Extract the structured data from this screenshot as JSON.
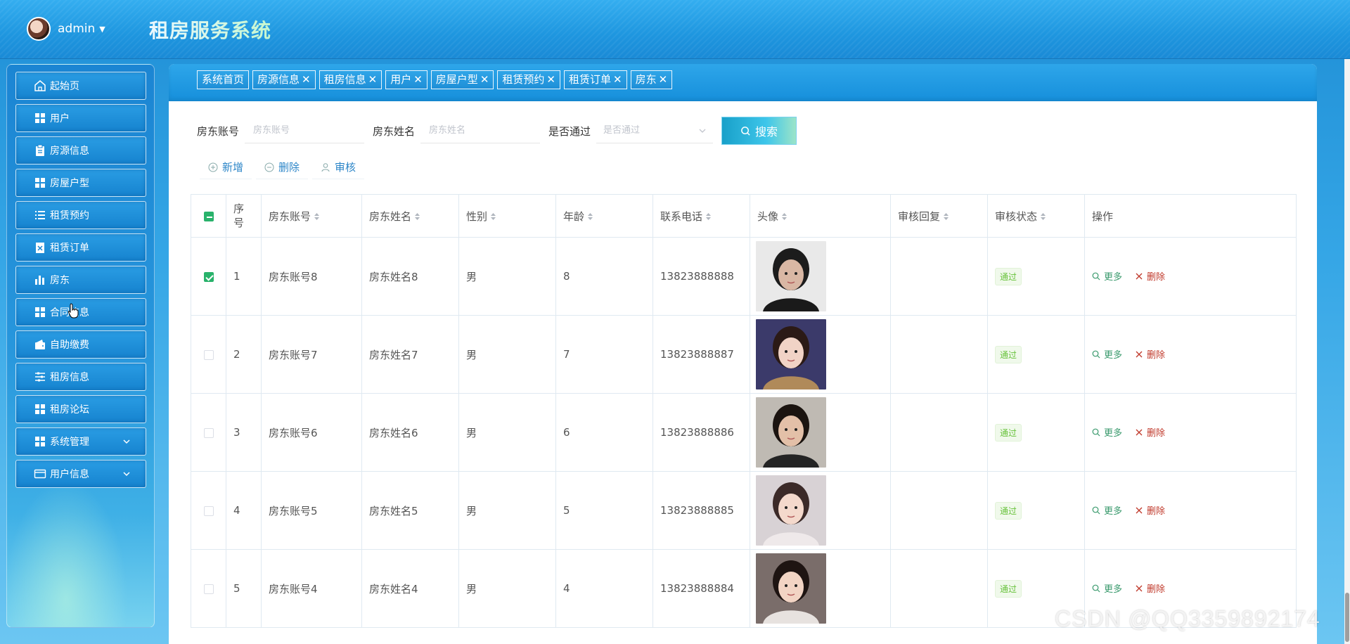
{
  "header": {
    "username": "admin",
    "app_title": "租房服务系统"
  },
  "sidebar": {
    "items": [
      {
        "label": "起始页",
        "icon": "home-icon"
      },
      {
        "label": "用户",
        "icon": "grid-icon"
      },
      {
        "label": "房源信息",
        "icon": "clipboard-icon"
      },
      {
        "label": "房屋户型",
        "icon": "grid-icon"
      },
      {
        "label": "租赁预约",
        "icon": "list-icon"
      },
      {
        "label": "租赁订单",
        "icon": "document-x-icon"
      },
      {
        "label": "房东",
        "icon": "bar-chart-icon"
      },
      {
        "label": "合同信息",
        "icon": "grid-icon"
      },
      {
        "label": "自助缴费",
        "icon": "wallet-icon"
      },
      {
        "label": "租房信息",
        "icon": "sliders-icon"
      },
      {
        "label": "租房论坛",
        "icon": "grid-icon"
      },
      {
        "label": "系统管理",
        "icon": "grid-icon",
        "expandable": true
      },
      {
        "label": "用户信息",
        "icon": "card-icon",
        "expandable": true
      }
    ]
  },
  "tabs": [
    {
      "label": "系统首页",
      "closable": false
    },
    {
      "label": "房源信息",
      "closable": true
    },
    {
      "label": "租房信息",
      "closable": true
    },
    {
      "label": "用户",
      "closable": true
    },
    {
      "label": "房屋户型",
      "closable": true
    },
    {
      "label": "租赁预约",
      "closable": true
    },
    {
      "label": "租赁订单",
      "closable": true
    },
    {
      "label": "房东",
      "closable": true
    }
  ],
  "search": {
    "account_label": "房东账号",
    "account_placeholder": "房东账号",
    "name_label": "房东姓名",
    "name_placeholder": "房东姓名",
    "approved_label": "是否通过",
    "approved_placeholder": "是否通过",
    "button_label": "搜索"
  },
  "actions": {
    "add_label": "新增",
    "delete_label": "删除",
    "review_label": "审核"
  },
  "table": {
    "columns": [
      "序号",
      "房东账号",
      "房东姓名",
      "性别",
      "年龄",
      "联系电话",
      "头像",
      "审核回复",
      "审核状态",
      "操作"
    ],
    "rows": [
      {
        "checked": true,
        "index": "1",
        "account": "房东账号8",
        "name": "房东姓名8",
        "gender": "男",
        "age": "8",
        "phone": "13823888888",
        "reply": "",
        "status": "通过"
      },
      {
        "checked": false,
        "index": "2",
        "account": "房东账号7",
        "name": "房东姓名7",
        "gender": "男",
        "age": "7",
        "phone": "13823888887",
        "reply": "",
        "status": "通过"
      },
      {
        "checked": false,
        "index": "3",
        "account": "房东账号6",
        "name": "房东姓名6",
        "gender": "男",
        "age": "6",
        "phone": "13823888886",
        "reply": "",
        "status": "通过"
      },
      {
        "checked": false,
        "index": "4",
        "account": "房东账号5",
        "name": "房东姓名5",
        "gender": "男",
        "age": "5",
        "phone": "13823888885",
        "reply": "",
        "status": "通过"
      },
      {
        "checked": false,
        "index": "5",
        "account": "房东账号4",
        "name": "房东姓名4",
        "gender": "男",
        "age": "4",
        "phone": "13823888884",
        "reply": "",
        "status": "通过"
      }
    ],
    "row_actions": {
      "more_label": "更多",
      "delete_label": "删除"
    }
  },
  "watermark": "CSDN @QQ3359892174",
  "colors": {
    "accent": "#1e96df",
    "status_green": "#67c23a",
    "more_green": "#3a9a6d",
    "delete_red": "#c0392b"
  }
}
